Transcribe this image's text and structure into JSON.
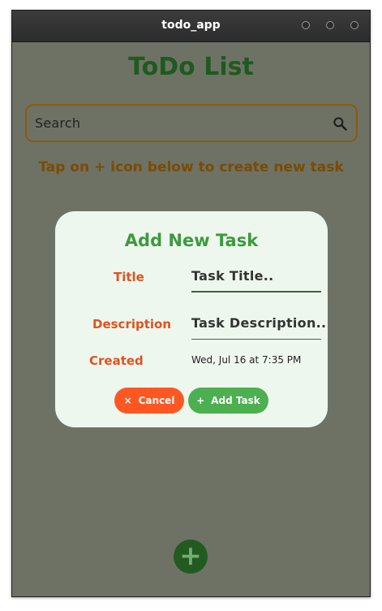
{
  "window": {
    "title": "todo_app"
  },
  "page": {
    "title": "ToDo List",
    "hint": "Tap on + icon below to create new task"
  },
  "search": {
    "placeholder": "Search",
    "icon": "search-icon"
  },
  "dialog": {
    "heading": "Add New Task",
    "title_label": "Title",
    "title_placeholder": "Task Title..",
    "description_label": "Description",
    "description_placeholder": "Task Description..",
    "created_label": "Created",
    "created_value": "Wed, Jul 16 at 7:35 PM",
    "cancel_icon": "×",
    "cancel_label": "Cancel",
    "add_icon": "+",
    "add_label": "Add Task"
  },
  "fab": {
    "icon": "+"
  },
  "colors": {
    "background": "#6e7264",
    "accent_green": "#4caf50",
    "cancel_orange": "#ff5722",
    "title_green": "#1e5a1f"
  }
}
